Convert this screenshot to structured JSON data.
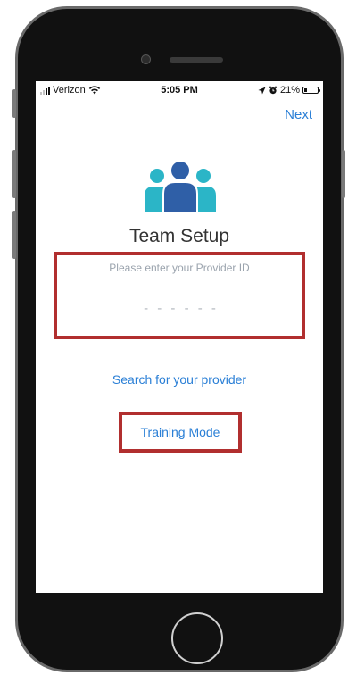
{
  "status_bar": {
    "carrier": "Verizon",
    "time": "5:05 PM",
    "battery_percent": "21%",
    "battery_level": 0.21,
    "icons": [
      "signal-icon",
      "wifi-icon",
      "location-icon",
      "alarm-icon",
      "battery-icon"
    ]
  },
  "nav": {
    "next_label": "Next"
  },
  "header": {
    "icon": "team-icon",
    "title": "Team Setup"
  },
  "provider": {
    "label": "Please enter your Provider ID",
    "placeholder": "- - - - - -",
    "value": ""
  },
  "links": {
    "search_label": "Search for your provider",
    "training_label": "Training Mode"
  },
  "colors": {
    "accent": "#2a7fd6",
    "highlight_border": "#b12f2f",
    "team_teal": "#2bb5c7",
    "team_blue": "#2f5fa7"
  }
}
